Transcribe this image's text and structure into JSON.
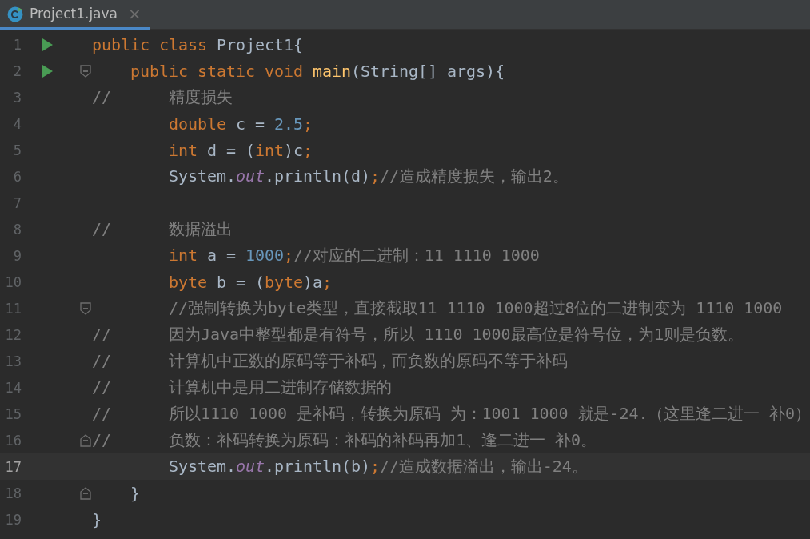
{
  "tabs": [
    {
      "label": "Project1.java",
      "close": "×",
      "selected": true
    }
  ],
  "lines": [
    {
      "number": "1",
      "run": true,
      "fold_open": false,
      "fold_close": false,
      "current": false,
      "tokens": [
        {
          "kind": "keyword",
          "text": "public class "
        },
        {
          "kind": "plain",
          "text": "Project1{"
        }
      ]
    },
    {
      "number": "2",
      "run": true,
      "fold_open": true,
      "fold_close": false,
      "current": false,
      "tokens": [
        {
          "kind": "keyword",
          "text": "    public static void "
        },
        {
          "kind": "method",
          "text": "main"
        },
        {
          "kind": "plain",
          "text": "(String[] args){"
        }
      ]
    },
    {
      "number": "3",
      "run": false,
      "fold_open": false,
      "fold_close": false,
      "current": false,
      "tokens": [
        {
          "kind": "comment",
          "text": "//      精度损失"
        }
      ]
    },
    {
      "number": "4",
      "run": false,
      "fold_open": false,
      "fold_close": false,
      "current": false,
      "tokens": [
        {
          "kind": "keyword",
          "text": "        double "
        },
        {
          "kind": "plain",
          "text": "c = "
        },
        {
          "kind": "number",
          "text": "2.5"
        },
        {
          "kind": "keyword",
          "text": ";"
        }
      ]
    },
    {
      "number": "5",
      "run": false,
      "fold_open": false,
      "fold_close": false,
      "current": false,
      "tokens": [
        {
          "kind": "keyword",
          "text": "        int "
        },
        {
          "kind": "plain",
          "text": "d = ("
        },
        {
          "kind": "keyword",
          "text": "int"
        },
        {
          "kind": "plain",
          "text": ")c"
        },
        {
          "kind": "keyword",
          "text": ";"
        }
      ]
    },
    {
      "number": "6",
      "run": false,
      "fold_open": false,
      "fold_close": false,
      "current": false,
      "tokens": [
        {
          "kind": "plain",
          "text": "        System."
        },
        {
          "kind": "field",
          "text": "out"
        },
        {
          "kind": "plain",
          "text": ".println(d)"
        },
        {
          "kind": "keyword",
          "text": ";"
        },
        {
          "kind": "comment",
          "text": "//造成精度损失，输出2。"
        }
      ]
    },
    {
      "number": "7",
      "run": false,
      "fold_open": false,
      "fold_close": false,
      "current": false
    },
    {
      "number": "8",
      "run": false,
      "fold_open": false,
      "fold_close": false,
      "current": false,
      "tokens": [
        {
          "kind": "comment",
          "text": "//      数据溢出"
        }
      ]
    },
    {
      "number": "9",
      "run": false,
      "fold_open": false,
      "fold_close": false,
      "current": false,
      "tokens": [
        {
          "kind": "keyword",
          "text": "        int "
        },
        {
          "kind": "plain",
          "text": "a = "
        },
        {
          "kind": "number",
          "text": "1000"
        },
        {
          "kind": "keyword",
          "text": ";"
        },
        {
          "kind": "comment",
          "text": "//对应的二进制：11 1110 1000"
        }
      ]
    },
    {
      "number": "10",
      "run": false,
      "fold_open": false,
      "fold_close": false,
      "current": false,
      "tokens": [
        {
          "kind": "keyword",
          "text": "        byte "
        },
        {
          "kind": "plain",
          "text": "b = ("
        },
        {
          "kind": "keyword",
          "text": "byte"
        },
        {
          "kind": "plain",
          "text": ")a"
        },
        {
          "kind": "keyword",
          "text": ";"
        }
      ]
    },
    {
      "number": "11",
      "run": false,
      "fold_open": true,
      "fold_close": false,
      "current": false,
      "tokens": [
        {
          "kind": "comment",
          "text": "        //强制转换为byte类型，直接截取11 1110 1000超过8位的二进制变为 1110 1000"
        }
      ]
    },
    {
      "number": "12",
      "run": false,
      "fold_open": false,
      "fold_close": false,
      "current": false,
      "tokens": [
        {
          "kind": "comment",
          "text": "//      因为Java中整型都是有符号，所以 1110 1000最高位是符号位，为1则是负数。"
        }
      ]
    },
    {
      "number": "13",
      "run": false,
      "fold_open": false,
      "fold_close": false,
      "current": false,
      "tokens": [
        {
          "kind": "comment",
          "text": "//      计算机中正数的原码等于补码，而负数的原码不等于补码"
        }
      ]
    },
    {
      "number": "14",
      "run": false,
      "fold_open": false,
      "fold_close": false,
      "current": false,
      "tokens": [
        {
          "kind": "comment",
          "text": "//      计算机中是用二进制存储数据的"
        }
      ]
    },
    {
      "number": "15",
      "run": false,
      "fold_open": false,
      "fold_close": false,
      "current": false,
      "tokens": [
        {
          "kind": "comment",
          "text": "//      所以1110 1000 是补码，转换为原码 为：1001 1000 就是-24.（这里逢二进一 补0）"
        }
      ]
    },
    {
      "number": "16",
      "run": false,
      "fold_open": false,
      "fold_close": true,
      "current": false,
      "tokens": [
        {
          "kind": "comment",
          "text": "//      负数：补码转换为原码：补码的补码再加1、逢二进一 补0。"
        }
      ]
    },
    {
      "number": "17",
      "run": false,
      "fold_open": false,
      "fold_close": false,
      "current": true,
      "tokens": [
        {
          "kind": "plain",
          "text": "        System."
        },
        {
          "kind": "field",
          "text": "out"
        },
        {
          "kind": "plain",
          "text": ".println(b)"
        },
        {
          "kind": "keyword",
          "text": ";"
        },
        {
          "kind": "comment",
          "text": "//造成数据溢出，输出-24。"
        }
      ]
    },
    {
      "number": "18",
      "run": false,
      "fold_open": false,
      "fold_close": true,
      "current": false,
      "tokens": [
        {
          "kind": "plain",
          "text": "    }"
        }
      ]
    },
    {
      "number": "19",
      "run": false,
      "fold_open": false,
      "fold_close": false,
      "current": false,
      "tokens": [
        {
          "kind": "plain",
          "text": "}"
        }
      ]
    }
  ]
}
